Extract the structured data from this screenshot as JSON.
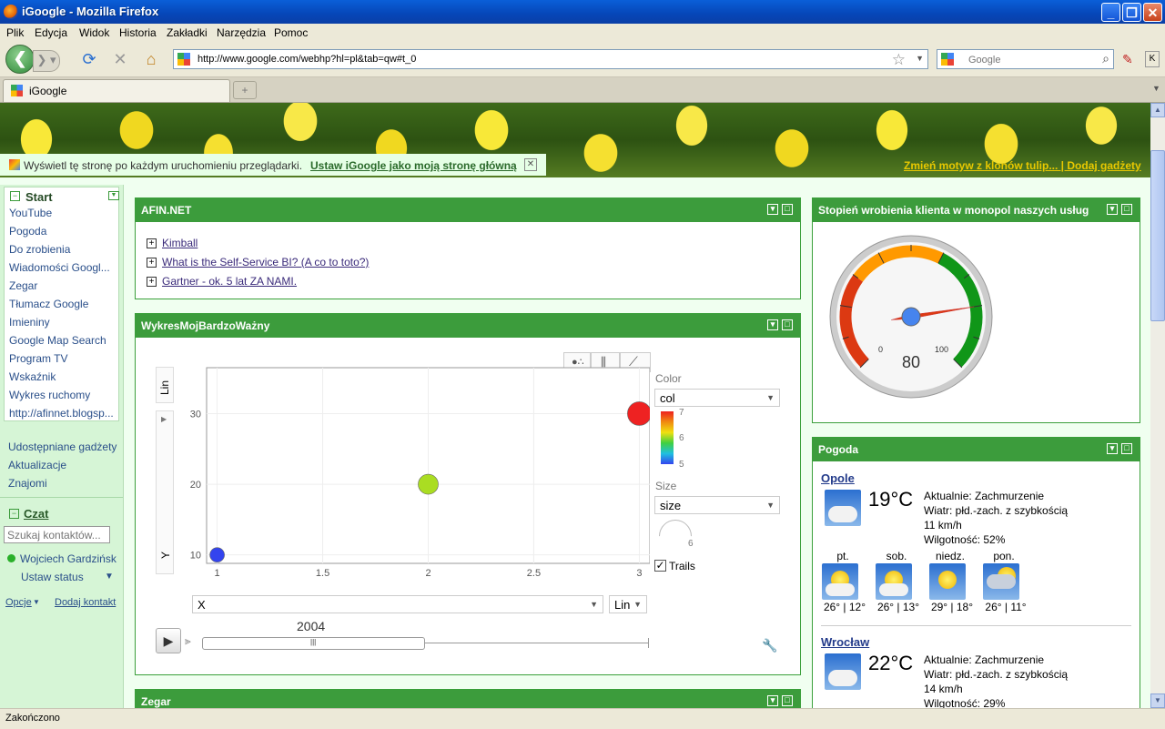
{
  "window": {
    "title": "iGoogle - Mozilla Firefox"
  },
  "menu": [
    "Plik",
    "Edycja",
    "Widok",
    "Historia",
    "Zakładki",
    "Narzędzia",
    "Pomoc"
  ],
  "nav": {
    "url": "http://www.google.com/webhp?hl=pl&tab=qw#t_0",
    "search_placeholder": "Google"
  },
  "tabs": [
    {
      "label": "iGoogle"
    }
  ],
  "banner": {
    "links": "Zmień motyw z klonów tulip... | Dodaj gadżety"
  },
  "infobar": {
    "text": "Wyświetl tę stronę po każdym uruchomieniu przeglądarki.",
    "link": "Ustaw iGoogle jako moją stronę główną"
  },
  "sidebar": {
    "start": "Start",
    "items": [
      "YouTube",
      "Pogoda",
      "Do zrobienia",
      "Wiadomości Googl...",
      "Zegar",
      "Tłumacz Google",
      "Imieniny",
      "Google Map Search",
      "Program TV",
      "Wskaźnik",
      "Wykres ruchomy",
      "http://afinnet.blogsp..."
    ],
    "links": [
      "Udostępniane gadżety",
      "Aktualizacje",
      "Znajomi"
    ],
    "chat": "Czat",
    "chat_search_placeholder": "Szukaj kontaktów...",
    "user": "Wojciech Gardziński",
    "status": "Ustaw status",
    "options": "Opcje",
    "add_contact": "Dodaj kontakt"
  },
  "afin": {
    "title": "AFIN.NET",
    "links": [
      "Kimball",
      "What is the Self-Service BI? (A co to toto?)",
      "Gartner - ok. 5 lat ZA NAMI."
    ]
  },
  "motion": {
    "title": "WykresMojBardzoWażny",
    "y_scale": "Lin",
    "y_label": "Y",
    "x_select": "X",
    "x_scale": "Lin",
    "color_label": "Color",
    "color_select": "col",
    "color_ticks": [
      "7",
      "6",
      "5"
    ],
    "size_label": "Size",
    "size_select": "size",
    "size_value": "6",
    "trails": "Trails",
    "year": "2004",
    "trails_checked": true
  },
  "chart_data": {
    "type": "scatter",
    "x": [
      1,
      2,
      3
    ],
    "y": [
      10,
      20,
      30
    ],
    "colors": [
      "#3344ee",
      "#aadd22",
      "#ee2222"
    ],
    "xlim": [
      0.95,
      3.05
    ],
    "ylim": [
      8.8,
      36.5
    ],
    "xticks": [
      1,
      1.5,
      2,
      2.5,
      3
    ],
    "xtick_labels": [
      "1",
      "1.5",
      "2",
      "2.5",
      "3"
    ],
    "yticks": [
      10,
      20,
      30
    ],
    "ytick_labels": [
      "10",
      "20",
      "30"
    ],
    "xlabel": "X",
    "ylabel": "Y",
    "grid": true
  },
  "gauge": {
    "title": "Stopień wrobienia klienta w monopol naszych usług",
    "value": "80",
    "min": "0",
    "max": "100",
    "needle_value": 80
  },
  "weather": {
    "title": "Pogoda",
    "cities": [
      {
        "name": "Opole",
        "temp": "19°C",
        "lines": [
          "Aktualnie: Zachmurzenie",
          "Wiatr: płd.-zach. z szybkością",
          "11 km/h",
          "Wilgotność: 52%"
        ]
      },
      {
        "name": "Wrocław",
        "temp": "22°C",
        "lines": [
          "Aktualnie: Zachmurzenie",
          "Wiatr: płd.-zach. z szybkością",
          "14 km/h",
          "Wilgotność: 29%"
        ]
      }
    ],
    "forecast": [
      {
        "day": "pt.",
        "temps": "26° | 12°"
      },
      {
        "day": "sob.",
        "temps": "26° | 13°"
      },
      {
        "day": "niedz.",
        "temps": "29° | 18°"
      },
      {
        "day": "pon.",
        "temps": "26° | 11°"
      }
    ]
  },
  "zegar": {
    "title": "Zegar"
  },
  "status": {
    "text": "Zakończono"
  }
}
